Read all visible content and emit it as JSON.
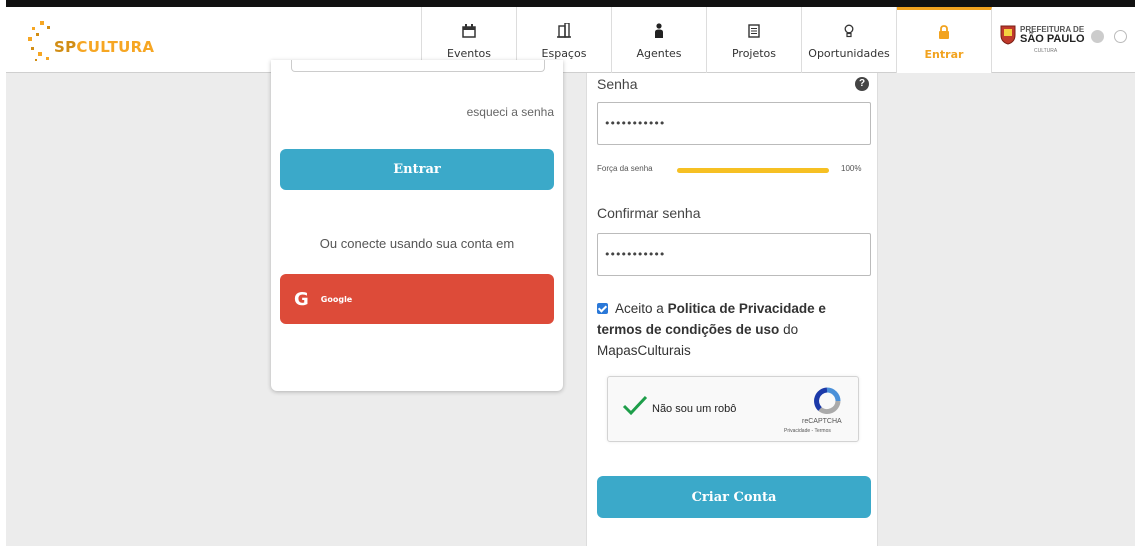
{
  "header": {
    "logo": {
      "sp": "SP",
      "cultura": "CULTURA"
    },
    "nav": [
      {
        "label": "Eventos",
        "icon": "calendar-icon"
      },
      {
        "label": "Espaços",
        "icon": "building-icon"
      },
      {
        "label": "Agentes",
        "icon": "person-icon"
      },
      {
        "label": "Projetos",
        "icon": "document-icon"
      },
      {
        "label": "Oportunidades",
        "icon": "lightbulb-icon"
      },
      {
        "label": "Entrar",
        "icon": "lock-icon",
        "active": true
      }
    ],
    "prefeitura": {
      "line1": "PREFEITURA DE",
      "line2": "SÃO PAULO",
      "line3": "CULTURA"
    },
    "accent_color": "#f2a31f"
  },
  "login": {
    "forgot": "esqueci a senha",
    "login_button": "Entrar",
    "social_text": "Ou conecte usando sua conta em",
    "google_g": "G",
    "google_label": "Google"
  },
  "register": {
    "password_label": "Senha",
    "help": "?",
    "password_value": "•••••••••••",
    "strength_label": "Força da senha",
    "strength_percent": "100%",
    "strength_value": 1.0,
    "confirm_label": "Confirmar senha",
    "confirm_value": "•••••••••••",
    "terms_prefix": "Aceito a",
    "terms_bold": "Politica de Privacidade e termos de condições de uso",
    "terms_suffix": "do MapasCulturais",
    "terms_checked": true,
    "captcha_label": "Não sou um robô",
    "captcha_brand": "reCAPTCHA",
    "captcha_links": "Privacidade - Termos",
    "create_button": "Criar Conta"
  },
  "colors": {
    "primary_button": "#3ba9c9",
    "google": "#dd4b39",
    "strength": "#f6c023"
  }
}
